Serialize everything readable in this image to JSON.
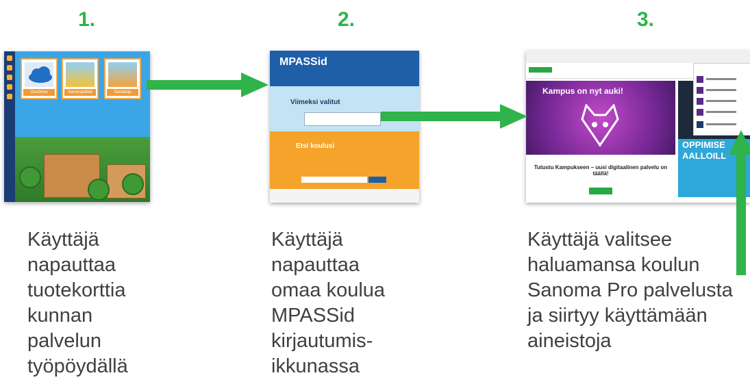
{
  "steps": [
    {
      "number": "1.",
      "caption": "Käyttäjä\nnapauttaa\ntuotekorttia\nkunnan\npalvelun\ntyöpöydällä",
      "screenshot": {
        "cards": [
          "OneDrive",
          "SanomaOleik",
          "Sanakirja"
        ]
      }
    },
    {
      "number": "2.",
      "caption": "Käyttäjä\nnapauttaa\nomaa koulua\nMPASSid\nkirjautumis-\nikkunassa",
      "screenshot": {
        "logo": "MPASSid",
        "recent_heading": "Viimeksi valitut",
        "search_heading": "Etsi koulusi"
      }
    },
    {
      "number": "3.",
      "caption": "Käyttäjä valitsee\nhaluamansa koulun\nSanoma Pro palvelusta\nja siirtyy käyttämään\naineistoja",
      "screenshot": {
        "hero_title": "Kampus on nyt auki!",
        "article_title": "Tutustu Kampukseen – uusi digitaalinen palvelu on täällä!",
        "ad_text": "OPPIMISE AALLOILL"
      }
    }
  ],
  "colors": {
    "step_number": "#2fb34a",
    "arrow": "#2fb34a",
    "caption_text": "#404040"
  }
}
